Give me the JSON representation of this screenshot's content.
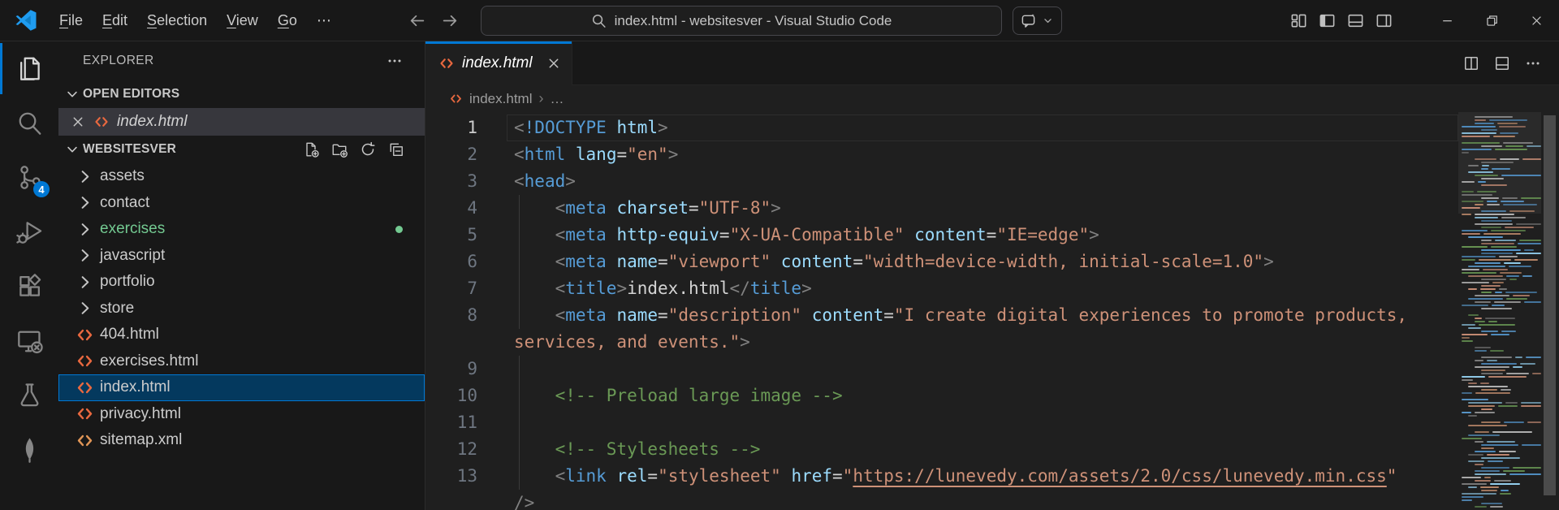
{
  "colors": {
    "accent": "#0078d4",
    "selection_bg": "#04395e",
    "git_untracked_green": "#73c991",
    "html_icon": "#e8683f",
    "xml_icon": "#e09556",
    "badge_bg": "#0078d4"
  },
  "title_bar": {
    "menus": [
      "File",
      "Edit",
      "Selection",
      "View",
      "Go"
    ],
    "overflow_menu": "⋯",
    "command_center": {
      "title": "index.html - websitesver - Visual Studio Code"
    }
  },
  "activity_bar": {
    "items": [
      {
        "id": "explorer",
        "active": true
      },
      {
        "id": "search"
      },
      {
        "id": "source-control",
        "badge": "4"
      },
      {
        "id": "run-and-debug"
      },
      {
        "id": "extensions"
      },
      {
        "id": "remote-explorer"
      },
      {
        "id": "testing"
      },
      {
        "id": "mongodb"
      }
    ]
  },
  "sidebar": {
    "title": "EXPLORER",
    "open_editors": {
      "label": "OPEN EDITORS",
      "items": [
        {
          "label": "index.html",
          "icon": "html",
          "preview": true
        }
      ]
    },
    "workspace": {
      "label": "WEBSITESVER",
      "items": [
        {
          "label": "assets",
          "type": "folder"
        },
        {
          "label": "contact",
          "type": "folder"
        },
        {
          "label": "exercises",
          "type": "folder",
          "git_untracked": true,
          "dot": true
        },
        {
          "label": "javascript",
          "type": "folder"
        },
        {
          "label": "portfolio",
          "type": "folder"
        },
        {
          "label": "store",
          "type": "folder"
        },
        {
          "label": "404.html",
          "type": "html"
        },
        {
          "label": "exercises.html",
          "type": "html"
        },
        {
          "label": "index.html",
          "type": "html",
          "selected": true
        },
        {
          "label": "privacy.html",
          "type": "html"
        },
        {
          "label": "sitemap.xml",
          "type": "xml"
        }
      ]
    }
  },
  "editor": {
    "tab": {
      "label": "index.html",
      "preview": true
    },
    "breadcrumb": {
      "file": "index.html",
      "tail": "…"
    },
    "code": {
      "rows": [
        {
          "n": "1",
          "cur": true,
          "g": false,
          "tk": [
            [
              "p",
              "<"
            ],
            [
              "t",
              "!DOCTYPE"
            ],
            [
              "a",
              " html"
            ],
            [
              "p",
              ">"
            ]
          ]
        },
        {
          "n": "2",
          "g": false,
          "tk": [
            [
              "p",
              "<"
            ],
            [
              "t",
              "html"
            ],
            [
              "x",
              " "
            ],
            [
              "a",
              "lang"
            ],
            [
              "x",
              "="
            ],
            [
              "s",
              "\"en\""
            ],
            [
              "p",
              ">"
            ]
          ]
        },
        {
          "n": "3",
          "g": false,
          "tk": [
            [
              "p",
              "<"
            ],
            [
              "t",
              "head"
            ],
            [
              "p",
              ">"
            ]
          ]
        },
        {
          "n": "4",
          "g": true,
          "tk": [
            [
              "x",
              "    "
            ],
            [
              "p",
              "<"
            ],
            [
              "t",
              "meta"
            ],
            [
              "x",
              " "
            ],
            [
              "a",
              "charset"
            ],
            [
              "x",
              "="
            ],
            [
              "s",
              "\"UTF-8\""
            ],
            [
              "p",
              ">"
            ]
          ]
        },
        {
          "n": "5",
          "g": true,
          "tk": [
            [
              "x",
              "    "
            ],
            [
              "p",
              "<"
            ],
            [
              "t",
              "meta"
            ],
            [
              "x",
              " "
            ],
            [
              "a",
              "http-equiv"
            ],
            [
              "x",
              "="
            ],
            [
              "s",
              "\"X-UA-Compatible\""
            ],
            [
              "x",
              " "
            ],
            [
              "a",
              "content"
            ],
            [
              "x",
              "="
            ],
            [
              "s",
              "\"IE=edge\""
            ],
            [
              "p",
              ">"
            ]
          ]
        },
        {
          "n": "6",
          "g": true,
          "tk": [
            [
              "x",
              "    "
            ],
            [
              "p",
              "<"
            ],
            [
              "t",
              "meta"
            ],
            [
              "x",
              " "
            ],
            [
              "a",
              "name"
            ],
            [
              "x",
              "="
            ],
            [
              "s",
              "\"viewport\""
            ],
            [
              "x",
              " "
            ],
            [
              "a",
              "content"
            ],
            [
              "x",
              "="
            ],
            [
              "s",
              "\"width=device-width, initial-scale=1.0\""
            ],
            [
              "p",
              ">"
            ]
          ]
        },
        {
          "n": "7",
          "g": true,
          "tk": [
            [
              "x",
              "    "
            ],
            [
              "p",
              "<"
            ],
            [
              "t",
              "title"
            ],
            [
              "p",
              ">"
            ],
            [
              "x",
              "index.html"
            ],
            [
              "p",
              "</"
            ],
            [
              "t",
              "title"
            ],
            [
              "p",
              ">"
            ]
          ]
        },
        {
          "n": "8",
          "g": true,
          "tk": [
            [
              "x",
              "    "
            ],
            [
              "p",
              "<"
            ],
            [
              "t",
              "meta"
            ],
            [
              "x",
              " "
            ],
            [
              "a",
              "name"
            ],
            [
              "x",
              "="
            ],
            [
              "s",
              "\"description\""
            ],
            [
              "x",
              " "
            ],
            [
              "a",
              "content"
            ],
            [
              "x",
              "="
            ],
            [
              "s",
              "\"I create digital experiences to promote products,"
            ]
          ]
        },
        {
          "n": "",
          "g": false,
          "tk": [
            [
              "s",
              "services, and events.\""
            ],
            [
              "p",
              ">"
            ]
          ]
        },
        {
          "n": "9",
          "g": true,
          "tk": []
        },
        {
          "n": "10",
          "g": true,
          "tk": [
            [
              "x",
              "    "
            ],
            [
              "c",
              "<!-- Preload large image -->"
            ]
          ]
        },
        {
          "n": "11",
          "g": true,
          "tk": []
        },
        {
          "n": "12",
          "g": true,
          "tk": [
            [
              "x",
              "    "
            ],
            [
              "c",
              "<!-- Stylesheets -->"
            ]
          ]
        },
        {
          "n": "13",
          "g": true,
          "tk": [
            [
              "x",
              "    "
            ],
            [
              "p",
              "<"
            ],
            [
              "t",
              "link"
            ],
            [
              "x",
              " "
            ],
            [
              "a",
              "rel"
            ],
            [
              "x",
              "="
            ],
            [
              "s",
              "\"stylesheet\""
            ],
            [
              "x",
              " "
            ],
            [
              "a",
              "href"
            ],
            [
              "x",
              "="
            ],
            [
              "s",
              "\""
            ],
            [
              "l",
              "https://lunevedy.com/assets/2.0/css/lunevedy.min.css"
            ],
            [
              "s",
              "\""
            ]
          ]
        },
        {
          "n": "",
          "g": false,
          "tk": [
            [
              "p",
              "/>"
            ]
          ]
        }
      ]
    }
  },
  "minimap": {
    "seed": 977,
    "rows": 122
  }
}
